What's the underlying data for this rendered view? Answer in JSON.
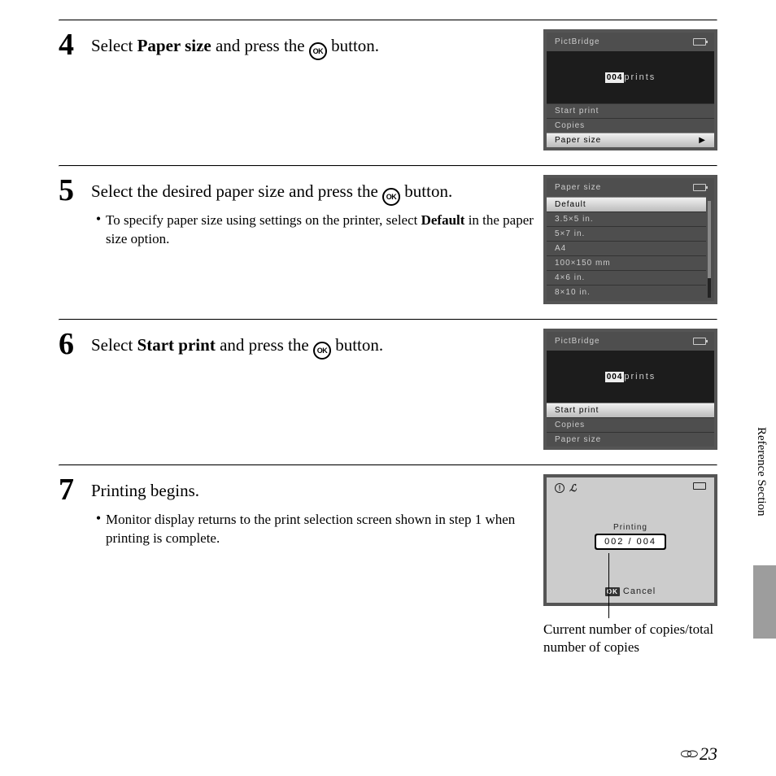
{
  "side_label": "Reference Section",
  "page_number": "23",
  "steps": {
    "s4": {
      "num": "4",
      "text_pre": "Select ",
      "text_bold": "Paper size",
      "text_post": " and press the ",
      "text_end": " button.",
      "screen": {
        "title": "PictBridge",
        "count": "004",
        "count_suffix": "prints",
        "items": [
          "Start print",
          "Copies",
          "Paper size"
        ],
        "selected": 2
      }
    },
    "s5": {
      "num": "5",
      "text_pre": "Select the desired paper size and press the ",
      "text_post": " button.",
      "bullet_pre": "To specify paper size using settings on the printer, select ",
      "bullet_bold": "Default",
      "bullet_post": " in the paper size option.",
      "screen": {
        "title": "Paper size",
        "items": [
          "Default",
          "3.5×5 in.",
          "5×7 in.",
          "A4",
          "100×150 mm",
          "4×6 in.",
          "8×10 in."
        ],
        "selected": 0
      }
    },
    "s6": {
      "num": "6",
      "text_pre": "Select ",
      "text_bold": "Start print",
      "text_post": " and press the ",
      "text_end": " button.",
      "screen": {
        "title": "PictBridge",
        "count": "004",
        "count_suffix": "prints",
        "items": [
          "Start print",
          "Copies",
          "Paper size"
        ],
        "selected": 0
      }
    },
    "s7": {
      "num": "7",
      "title": "Printing begins.",
      "bullet": "Monitor display returns to the print selection screen shown in step 1 when printing is complete.",
      "screen": {
        "status": "Printing",
        "counter": "002 / 004",
        "cancel": "Cancel"
      },
      "caption": "Current number of copies/total number of copies"
    }
  }
}
